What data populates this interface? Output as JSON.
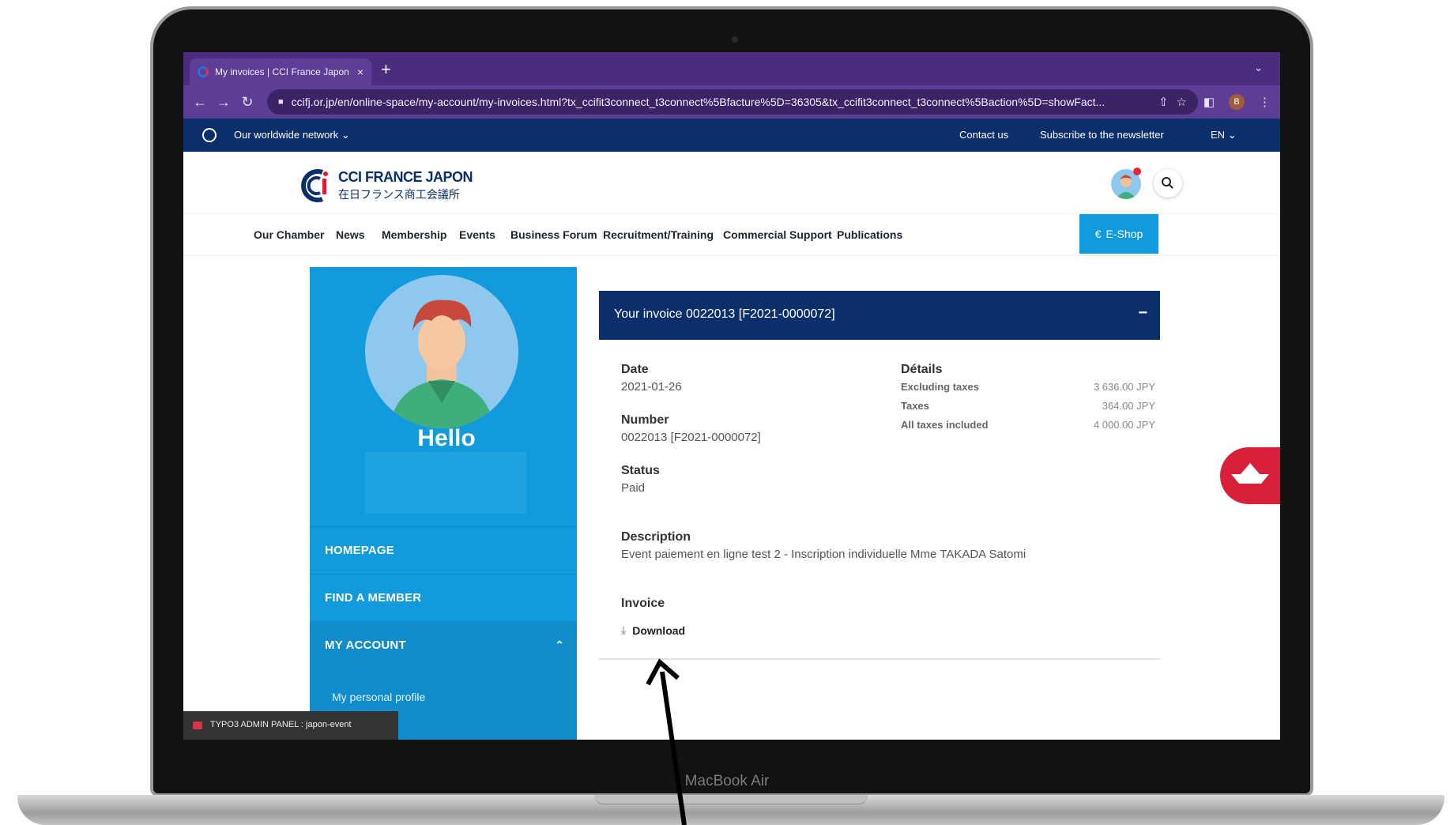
{
  "device": {
    "label": "MacBook Air"
  },
  "browser": {
    "tab_title": "My invoices | CCI France Japon",
    "tab_close": "×",
    "new_tab": "+",
    "url": "ccifj.or.jp/en/online-space/my-account/my-invoices.html?tx_ccifit3connect_t3connect%5Bfacture%5D=36305&tx_ccifit3connect_t3connect%5Baction%5D=showFact...",
    "profile_initial": "B"
  },
  "topbar": {
    "network": "Our worldwide network",
    "contact": "Contact us",
    "newsletter": "Subscribe to the newsletter",
    "language": "EN"
  },
  "logo": {
    "line1": "CCI FRANCE JAPON",
    "line2": "在日フランス商工会議所"
  },
  "nav": {
    "items": [
      "Our Chamber",
      "News",
      "Membership",
      "Events",
      "Business Forum",
      "Recruitment/Training",
      "Commercial Support",
      "Publications"
    ],
    "eshop": "E-Shop"
  },
  "sidebar": {
    "greeting": "Hello",
    "items": [
      "HOMEPAGE",
      "FIND A MEMBER",
      "MY ACCOUNT"
    ],
    "sub_items": [
      "My personal profile"
    ]
  },
  "invoice": {
    "header": "Your invoice 0022013 [F2021-0000072]",
    "collapse": "−",
    "date_label": "Date",
    "date_value": "2021-01-26",
    "number_label": "Number",
    "number_value": "0022013 [F2021-0000072]",
    "status_label": "Status",
    "status_value": "Paid",
    "description_label": "Description",
    "description_value": "Event paiement en ligne test 2 - Inscription individuelle Mme TAKADA Satomi",
    "invoice_label": "Invoice",
    "download": "Download",
    "details": {
      "label": "Détails",
      "rows": [
        {
          "label": "Excluding taxes",
          "value": "3 636.00 JPY"
        },
        {
          "label": "Taxes",
          "value": "364.00 JPY"
        },
        {
          "label": "All taxes included",
          "value": "4 000.00 JPY"
        }
      ]
    }
  },
  "admin_panel": {
    "text": "TYPO3 ADMIN PANEL : japon-event"
  },
  "colors": {
    "browser_purple": "#5e3d96",
    "site_navy": "#0b2f6a",
    "accent_blue": "#119adc",
    "float_red": "#d8203a"
  }
}
